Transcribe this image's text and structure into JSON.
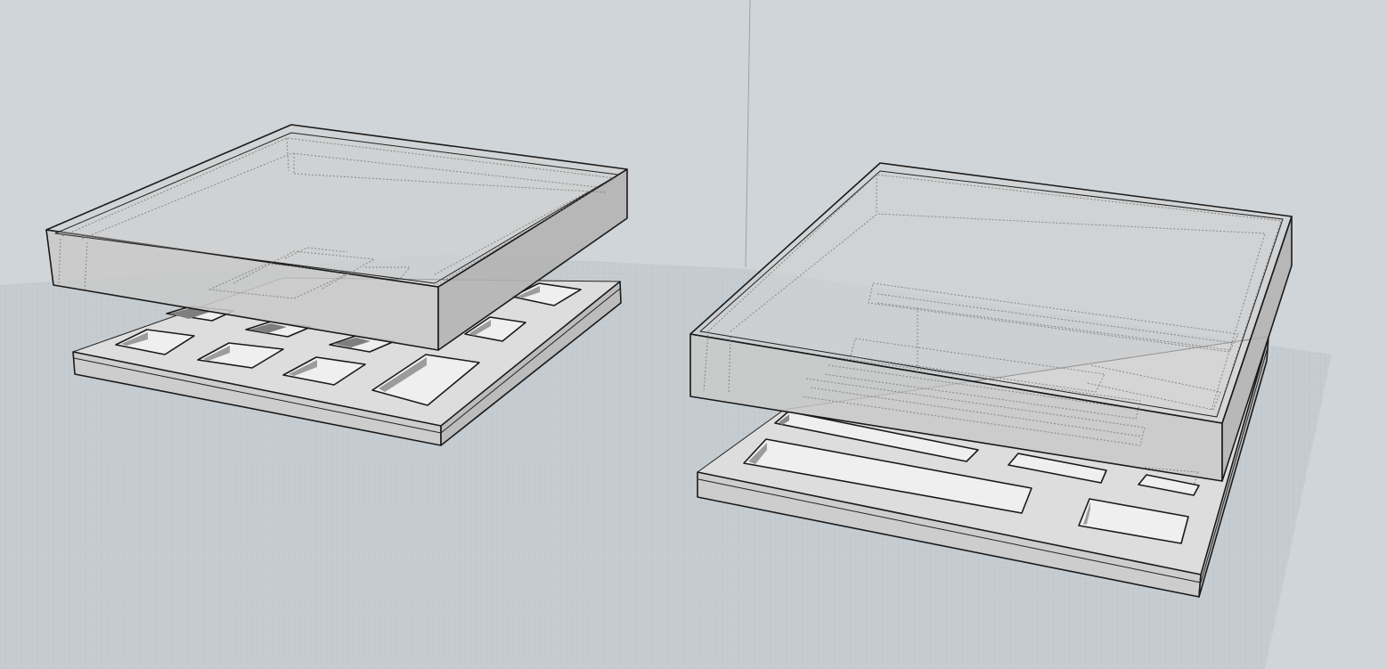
{
  "viewport": {
    "view_mode": "perspective",
    "style": "hidden-line-xray",
    "colors": {
      "background": "#d0d5d9",
      "ground_grid": "#c4cbd0",
      "ground_lines": "#b3bcc3",
      "top_face": "#dcdcdc",
      "side_face": "#b9b9b9",
      "front_face": "#cfcfcf",
      "lid_fill": "#c8c8c8",
      "edge": "#1a1a1a"
    }
  },
  "models": [
    {
      "name": "square-tray-box",
      "parts": [
        "lid",
        "base-tray"
      ],
      "pocket_count": 12
    },
    {
      "name": "rectangular-tray-box",
      "parts": [
        "lid",
        "base-tray"
      ],
      "pocket_count": 5
    }
  ]
}
